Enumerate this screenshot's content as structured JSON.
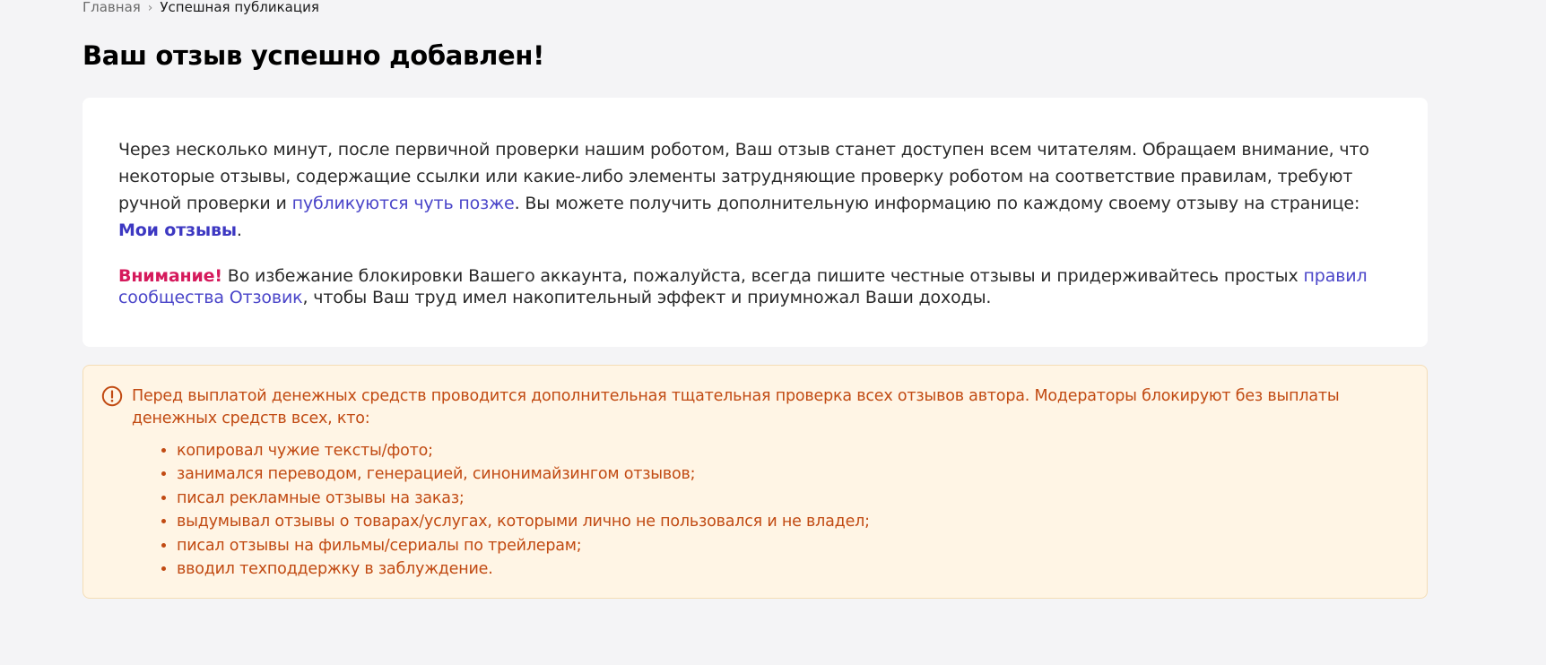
{
  "breadcrumb": {
    "home": "Главная",
    "separator": "›",
    "current": "Успешная публикация"
  },
  "title": "Ваш отзыв успешно добавлен!",
  "info": {
    "text_before_link": "Через несколько минут, после первичной проверки нашим роботом, Ваш отзыв станет доступен всем читателям. Обращаем внимание, что некоторые отзывы, содержащие ссылки или какие-либо элементы затрудняющие проверку роботом на соответствие правилам, требуют ручной проверки и ",
    "later_link": "публикуются чуть позже",
    "text_after_link": ". Вы можете получить дополнительную информацию по каждому своему отзыву на странице: ",
    "my_reviews_link": "Мои отзывы",
    "end": "."
  },
  "attention": {
    "label": "Внимание!",
    "text_before_link": " Во избежание блокировки Вашего аккаунта, пожалуйста, всегда пишите честные отзывы и придерживайтесь простых ",
    "rules_link": "правил сообщества Отзовик",
    "text_after_link": ", чтобы Ваш труд имел накопительный эффект и приумножал Ваши доходы."
  },
  "warning": {
    "icon": "exclamation-circle-icon",
    "text": "Перед выплатой денежных средств проводится дополнительная тщательная проверка всех отзывов автора. Модераторы блокируют без выплаты денежных средств всех, кто:",
    "items": [
      "копировал чужие тексты/фото;",
      "занимался переводом, генерацией, синонимайзингом отзывов;",
      "писал рекламные отзывы на заказ;",
      "выдумывал отзывы о товарах/услугах, которыми лично не пользовался и не владел;",
      "писал отзывы на фильмы/сериалы по трейлерам;",
      "вводил техподдержку в заблуждение."
    ]
  },
  "colors": {
    "background": "#f4f4f6",
    "link": "#4a45c9",
    "attention": "#d51a5c",
    "warning_text": "#c14a12",
    "warning_bg": "#fff5e5",
    "warning_border": "#f4ddb6"
  }
}
